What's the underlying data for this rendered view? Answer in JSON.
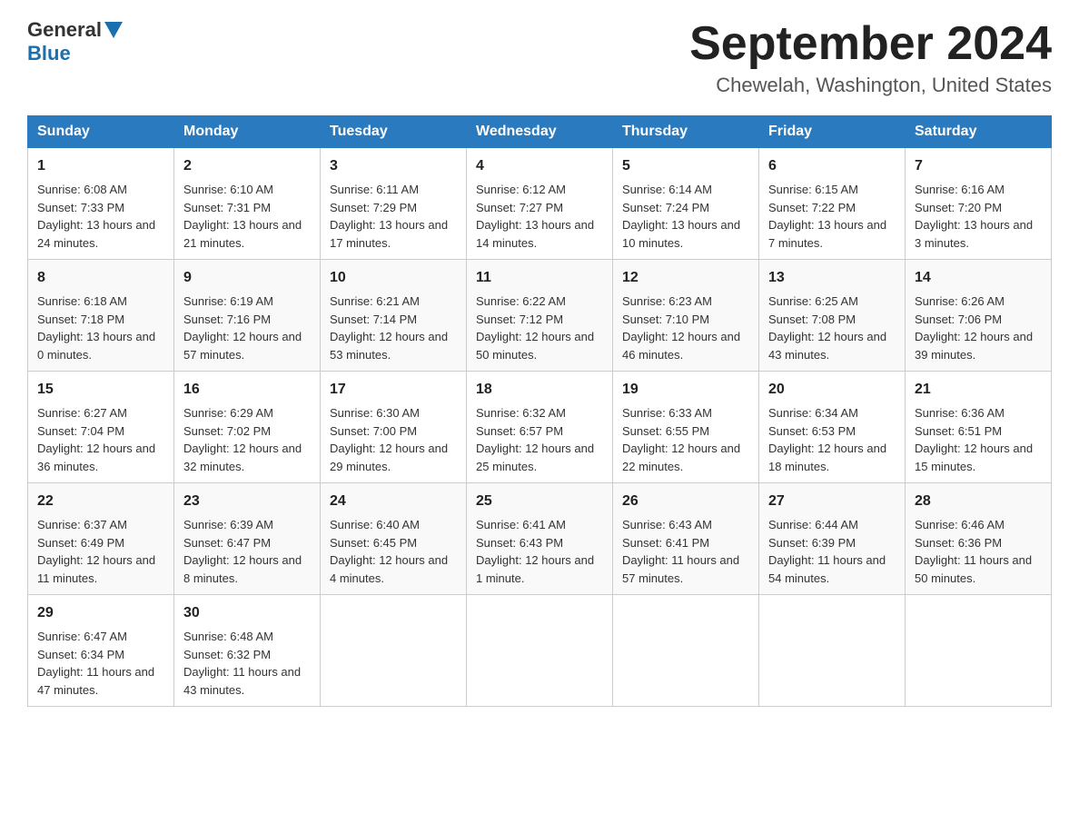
{
  "header": {
    "logo_general": "General",
    "logo_blue": "Blue",
    "month_title": "September 2024",
    "location": "Chewelah, Washington, United States"
  },
  "days_of_week": [
    "Sunday",
    "Monday",
    "Tuesday",
    "Wednesday",
    "Thursday",
    "Friday",
    "Saturday"
  ],
  "weeks": [
    [
      {
        "day": "1",
        "sunrise": "6:08 AM",
        "sunset": "7:33 PM",
        "daylight": "13 hours and 24 minutes."
      },
      {
        "day": "2",
        "sunrise": "6:10 AM",
        "sunset": "7:31 PM",
        "daylight": "13 hours and 21 minutes."
      },
      {
        "day": "3",
        "sunrise": "6:11 AM",
        "sunset": "7:29 PM",
        "daylight": "13 hours and 17 minutes."
      },
      {
        "day": "4",
        "sunrise": "6:12 AM",
        "sunset": "7:27 PM",
        "daylight": "13 hours and 14 minutes."
      },
      {
        "day": "5",
        "sunrise": "6:14 AM",
        "sunset": "7:24 PM",
        "daylight": "13 hours and 10 minutes."
      },
      {
        "day": "6",
        "sunrise": "6:15 AM",
        "sunset": "7:22 PM",
        "daylight": "13 hours and 7 minutes."
      },
      {
        "day": "7",
        "sunrise": "6:16 AM",
        "sunset": "7:20 PM",
        "daylight": "13 hours and 3 minutes."
      }
    ],
    [
      {
        "day": "8",
        "sunrise": "6:18 AM",
        "sunset": "7:18 PM",
        "daylight": "13 hours and 0 minutes."
      },
      {
        "day": "9",
        "sunrise": "6:19 AM",
        "sunset": "7:16 PM",
        "daylight": "12 hours and 57 minutes."
      },
      {
        "day": "10",
        "sunrise": "6:21 AM",
        "sunset": "7:14 PM",
        "daylight": "12 hours and 53 minutes."
      },
      {
        "day": "11",
        "sunrise": "6:22 AM",
        "sunset": "7:12 PM",
        "daylight": "12 hours and 50 minutes."
      },
      {
        "day": "12",
        "sunrise": "6:23 AM",
        "sunset": "7:10 PM",
        "daylight": "12 hours and 46 minutes."
      },
      {
        "day": "13",
        "sunrise": "6:25 AM",
        "sunset": "7:08 PM",
        "daylight": "12 hours and 43 minutes."
      },
      {
        "day": "14",
        "sunrise": "6:26 AM",
        "sunset": "7:06 PM",
        "daylight": "12 hours and 39 minutes."
      }
    ],
    [
      {
        "day": "15",
        "sunrise": "6:27 AM",
        "sunset": "7:04 PM",
        "daylight": "12 hours and 36 minutes."
      },
      {
        "day": "16",
        "sunrise": "6:29 AM",
        "sunset": "7:02 PM",
        "daylight": "12 hours and 32 minutes."
      },
      {
        "day": "17",
        "sunrise": "6:30 AM",
        "sunset": "7:00 PM",
        "daylight": "12 hours and 29 minutes."
      },
      {
        "day": "18",
        "sunrise": "6:32 AM",
        "sunset": "6:57 PM",
        "daylight": "12 hours and 25 minutes."
      },
      {
        "day": "19",
        "sunrise": "6:33 AM",
        "sunset": "6:55 PM",
        "daylight": "12 hours and 22 minutes."
      },
      {
        "day": "20",
        "sunrise": "6:34 AM",
        "sunset": "6:53 PM",
        "daylight": "12 hours and 18 minutes."
      },
      {
        "day": "21",
        "sunrise": "6:36 AM",
        "sunset": "6:51 PM",
        "daylight": "12 hours and 15 minutes."
      }
    ],
    [
      {
        "day": "22",
        "sunrise": "6:37 AM",
        "sunset": "6:49 PM",
        "daylight": "12 hours and 11 minutes."
      },
      {
        "day": "23",
        "sunrise": "6:39 AM",
        "sunset": "6:47 PM",
        "daylight": "12 hours and 8 minutes."
      },
      {
        "day": "24",
        "sunrise": "6:40 AM",
        "sunset": "6:45 PM",
        "daylight": "12 hours and 4 minutes."
      },
      {
        "day": "25",
        "sunrise": "6:41 AM",
        "sunset": "6:43 PM",
        "daylight": "12 hours and 1 minute."
      },
      {
        "day": "26",
        "sunrise": "6:43 AM",
        "sunset": "6:41 PM",
        "daylight": "11 hours and 57 minutes."
      },
      {
        "day": "27",
        "sunrise": "6:44 AM",
        "sunset": "6:39 PM",
        "daylight": "11 hours and 54 minutes."
      },
      {
        "day": "28",
        "sunrise": "6:46 AM",
        "sunset": "6:36 PM",
        "daylight": "11 hours and 50 minutes."
      }
    ],
    [
      {
        "day": "29",
        "sunrise": "6:47 AM",
        "sunset": "6:34 PM",
        "daylight": "11 hours and 47 minutes."
      },
      {
        "day": "30",
        "sunrise": "6:48 AM",
        "sunset": "6:32 PM",
        "daylight": "11 hours and 43 minutes."
      },
      null,
      null,
      null,
      null,
      null
    ]
  ]
}
